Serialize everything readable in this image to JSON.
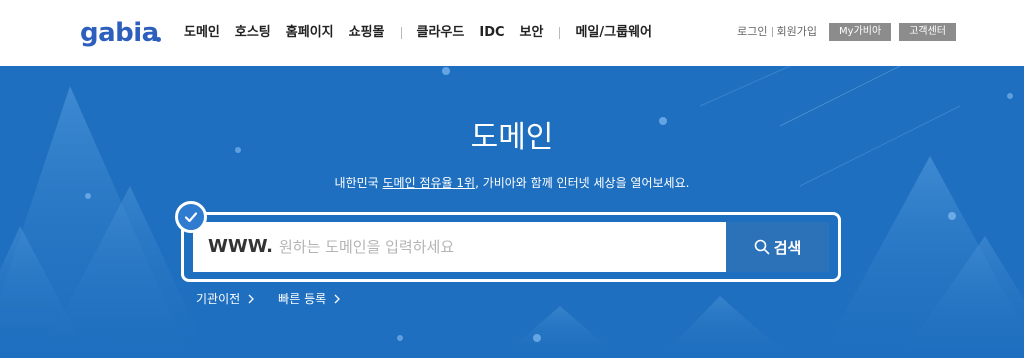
{
  "logo": {
    "text": "gabia",
    "icon": "gabia-logo"
  },
  "nav": {
    "items": [
      "도메인",
      "호스팅",
      "홈페이지",
      "쇼핑몰",
      "클라우드",
      "IDC",
      "보안",
      "메일/그룹웨어"
    ]
  },
  "util": {
    "login": "로그인",
    "signup": "회원가입",
    "my_gabia": "My가비아",
    "customer_center": "고객센터"
  },
  "hero": {
    "title": "도메인",
    "subtitle_pre": "내한민국 ",
    "subtitle_link": "도메인 점유율 1위",
    "subtitle_post": ", 가비아와 함께 인터넷 세상을 열어보세요.",
    "search_prefix": "WWW.",
    "search_placeholder": "원하는 도메인을 입력하세요",
    "search_value": "",
    "search_button": "검색",
    "links": [
      "기관이전",
      "빠른 등록"
    ]
  },
  "colors": {
    "hero_bg": "#1e6fbf",
    "search_btn": "#2c72b9",
    "logo": "#2d5fbd",
    "util_btn": "#8c8c8c"
  }
}
